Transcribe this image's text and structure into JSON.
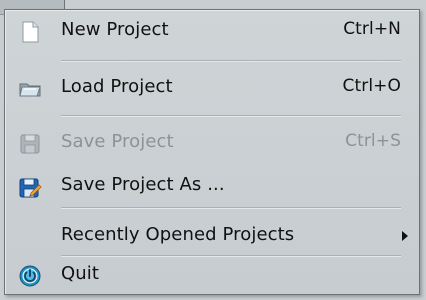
{
  "menu": {
    "items": [
      {
        "label": "New Project",
        "shortcut": "Ctrl+N",
        "icon": "new-document-icon",
        "enabled": true
      },
      {
        "label": "Load Project",
        "shortcut": "Ctrl+O",
        "icon": "load-folder-icon",
        "enabled": true
      },
      {
        "label": "Save Project",
        "shortcut": "Ctrl+S",
        "icon": "save-disk-icon",
        "enabled": false
      },
      {
        "label": "Save Project As ...",
        "shortcut": "",
        "icon": "save-as-icon",
        "enabled": true
      },
      {
        "label": "Recently Opened Projects",
        "shortcut": "",
        "icon": "",
        "enabled": true,
        "submenu": true
      },
      {
        "label": "Quit",
        "shortcut": "",
        "icon": "quit-icon",
        "enabled": true
      }
    ]
  },
  "colors": {
    "menu_bg": "#cbd0d3",
    "text": "#111111",
    "disabled_text": "#8c9296",
    "separator": "#aab1b5"
  }
}
